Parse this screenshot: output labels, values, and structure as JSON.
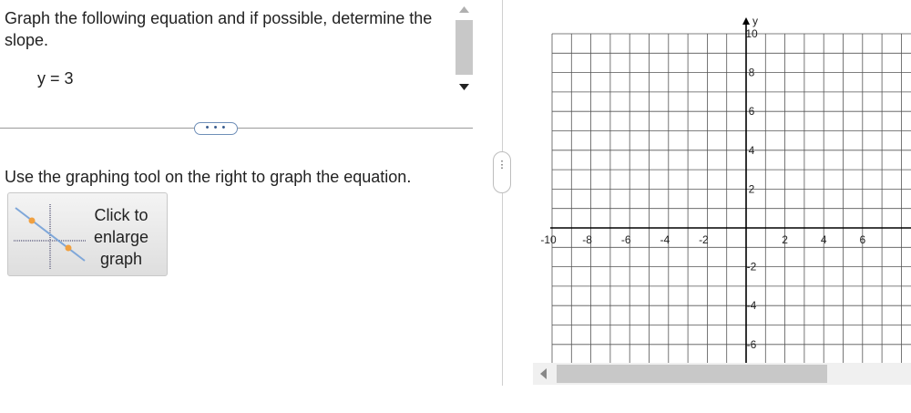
{
  "question": {
    "prompt": "Graph the following equation and if possible, determine the slope.",
    "equation": "y = 3",
    "more_label": "• • •"
  },
  "workspace": {
    "instruction": "Use the graphing tool on the right to graph the equation.",
    "enlarge_label": "Click to enlarge graph",
    "splitter_label": "⋮"
  },
  "graph": {
    "axis_y_label": "y",
    "x_ticks": [
      -10,
      -8,
      -6,
      -4,
      -2,
      2,
      4,
      6
    ],
    "y_ticks": [
      10,
      8,
      6,
      4,
      2,
      -2,
      -4,
      -6
    ],
    "x_range": [
      -10,
      8
    ],
    "y_range": [
      -7,
      10
    ],
    "grid_step": 1,
    "colors": {
      "grid": "#555555",
      "axis": "#000000",
      "tick_text": "#222222"
    }
  },
  "icons": {
    "scroll_up": "triangle-up-icon",
    "scroll_down": "triangle-down-icon",
    "scroll_left": "triangle-left-icon",
    "enlarge": "graph-thumbnail-icon"
  }
}
